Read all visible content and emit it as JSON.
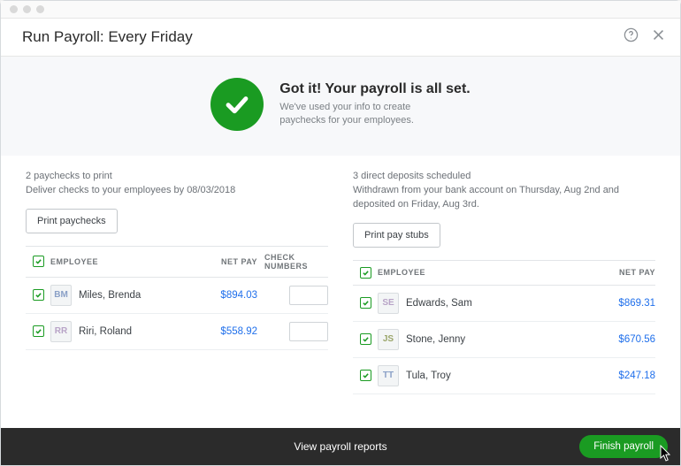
{
  "header": {
    "title": "Run Payroll: Every Friday"
  },
  "hero": {
    "title": "Got it! Your payroll is all set.",
    "line1": "We've used your info to create",
    "line2": "paychecks for your employees."
  },
  "left": {
    "summary_title": "2 paychecks to print",
    "summary_sub": "Deliver checks to your employees by 08/03/2018",
    "button_label": "Print paychecks",
    "columns": {
      "employee": "EMPLOYEE",
      "netpay": "NET PAY",
      "checknum": "CHECK NUMBERS"
    },
    "rows": [
      {
        "initials": "BM",
        "cls": "bm",
        "name": "Miles, Brenda",
        "net": "$894.03"
      },
      {
        "initials": "RR",
        "cls": "rr",
        "name": "Riri, Roland",
        "net": "$558.92"
      }
    ]
  },
  "right": {
    "summary_title": "3 direct deposits scheduled",
    "summary_sub": "Withdrawn from your bank account on Thursday, Aug 2nd and deposited on Friday, Aug 3rd.",
    "button_label": "Print pay stubs",
    "columns": {
      "employee": "EMPLOYEE",
      "netpay": "NET PAY"
    },
    "rows": [
      {
        "initials": "SE",
        "cls": "se",
        "name": "Edwards, Sam",
        "net": "$869.31"
      },
      {
        "initials": "JS",
        "cls": "js",
        "name": "Stone, Jenny",
        "net": "$670.56"
      },
      {
        "initials": "TT",
        "cls": "tt",
        "name": "Tula, Troy",
        "net": "$247.18"
      }
    ]
  },
  "footer": {
    "reports_label": "View payroll reports",
    "finish_label": "Finish payroll"
  }
}
